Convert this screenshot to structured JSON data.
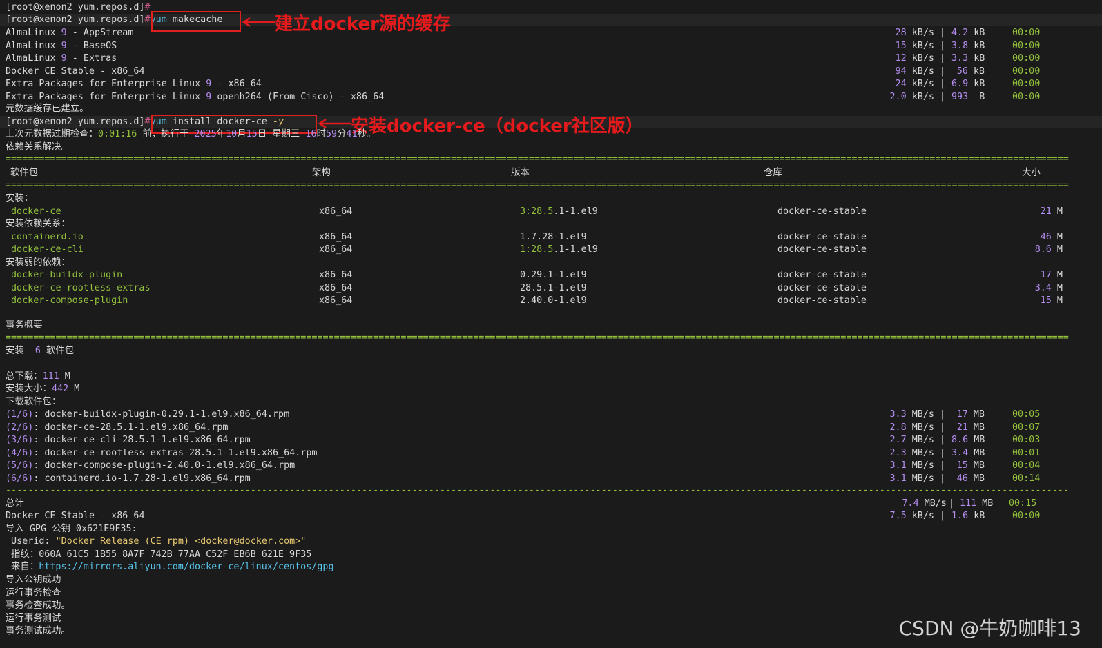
{
  "prompt": {
    "p1": "[root@xenon2 yum.repos.d]",
    "hash": "#",
    "cmd1": "yum makecache",
    "cmd2a": "yum install docker-ce ",
    "cmd2b": "-y"
  },
  "annotations": {
    "a1": "建立docker源的缓存",
    "a2": "安装docker-ce（docker社区版）"
  },
  "makecache": [
    {
      "name": "AlmaLinux ",
      "n": "9",
      "rest": " - AppStream",
      "speed": "28",
      "sunit": " kB/s",
      "size": "4.2",
      "zunit": " kB",
      "time": "00:00"
    },
    {
      "name": "AlmaLinux ",
      "n": "9",
      "rest": " - BaseOS",
      "speed": "15",
      "sunit": " kB/s",
      "size": "3.8",
      "zunit": " kB",
      "time": "00:00"
    },
    {
      "name": "AlmaLinux ",
      "n": "9",
      "rest": " - Extras",
      "speed": "12",
      "sunit": " kB/s",
      "size": "3.3",
      "zunit": " kB",
      "time": "00:00"
    },
    {
      "name": "Docker CE Stable - x86_64",
      "n": "",
      "rest": "",
      "speed": "94",
      "sunit": " kB/s",
      "size": "56",
      "zunit": " kB",
      "time": "00:00"
    },
    {
      "name": "Extra Packages for Enterprise Linux ",
      "n": "9",
      "rest": " - x86_64",
      "speed": "24",
      "sunit": " kB/s",
      "size": "6.9",
      "zunit": " kB",
      "time": "00:00"
    },
    {
      "name": "Extra Packages for Enterprise Linux ",
      "n": "9",
      "rest": " openh264 (From Cisco) - x86_64",
      "speed": "2.0",
      "sunit": " kB/s",
      "size": "993",
      "zunit": "  B",
      "time": "00:00"
    }
  ],
  "cache_done": "元数据缓存已建立。",
  "meta_check": {
    "pre": "上次元数据过期检查：",
    "elapsed": "0:01:16",
    "mid": " 前，执行于 ",
    "year": "2025",
    "y": "年",
    "month": "10",
    "m": "月",
    "day": "15",
    "d": "日 星期三 ",
    "hour": "16",
    "h": "时",
    "min": "59",
    "mi": "分",
    "sec": "41",
    "s": "秒。"
  },
  "deps_resolved": "依赖关系解决。",
  "eq_rule": "================================================================================================================================================================================================",
  "dash_rule": "----------------------------------------------------------------------------------------------------------------------------------------------------------------------------------------------------------------",
  "table_header": {
    "pkg": "软件包",
    "arch": "架构",
    "ver": "版本",
    "repo": "仓库",
    "size": "大小"
  },
  "sections": [
    {
      "title": "安装：",
      "rows": [
        {
          "pkg": "docker-ce",
          "arch": "x86_64",
          "ver_a": "3:28.5",
          "ver_b": ".1-1.el9",
          "verColor": true,
          "repo": "docker-ce-stable",
          "size": "21",
          "unit": " M"
        }
      ]
    },
    {
      "title": "安装依赖关系：",
      "rows": [
        {
          "pkg": "containerd.io",
          "arch": "x86_64",
          "ver_a": "",
          "ver_b": "1.7.28-1.el9",
          "verColor": false,
          "repo": "docker-ce-stable",
          "size": "46",
          "unit": " M"
        },
        {
          "pkg": "docker-ce-cli",
          "arch": "x86_64",
          "ver_a": "1:28.5",
          "ver_b": ".1-1.el9",
          "verColor": true,
          "repo": "docker-ce-stable",
          "size": "8.6",
          "unit": " M"
        }
      ]
    },
    {
      "title": "安装弱的依赖：",
      "rows": [
        {
          "pkg": "docker-buildx-plugin",
          "arch": "x86_64",
          "ver_a": "",
          "ver_b": "0.29.1-1.el9",
          "verColor": false,
          "repo": "docker-ce-stable",
          "size": "17",
          "unit": " M"
        },
        {
          "pkg": "docker-ce-rootless-extras",
          "arch": "x86_64",
          "ver_a": "",
          "ver_b": "28.5.1-1.el9",
          "verColor": false,
          "repo": "docker-ce-stable",
          "size": "3.4",
          "unit": " M"
        },
        {
          "pkg": "docker-compose-plugin",
          "arch": "x86_64",
          "ver_a": "",
          "ver_b": "2.40.0-1.el9",
          "verColor": false,
          "repo": "docker-ce-stable",
          "size": "15",
          "unit": " M"
        }
      ]
    }
  ],
  "summary": {
    "title": "事务概要",
    "install_pre": "安装  ",
    "install_n": "6",
    "install_post": " 软件包",
    "dl_pre": "总下载：",
    "dl_n": "111",
    "dl_post": " M",
    "inst_pre": "安装大小：",
    "inst_n": "442",
    "inst_post": " M",
    "dl_label": "下载软件包："
  },
  "downloads": [
    {
      "idx": "(1/6)",
      "file": ": docker-buildx-plugin-0.29.1-1.el9.x86_64.rpm",
      "speed": "3.3",
      "sunit": " MB/s",
      "size": "17",
      "zunit": " MB",
      "time": "00:05"
    },
    {
      "idx": "(2/6)",
      "file": ": docker-ce-28.5.1-1.el9.x86_64.rpm",
      "speed": "2.8",
      "sunit": " MB/s",
      "size": "21",
      "zunit": " MB",
      "time": "00:07"
    },
    {
      "idx": "(3/6)",
      "file": ": docker-ce-cli-28.5.1-1.el9.x86_64.rpm",
      "speed": "2.7",
      "sunit": " MB/s",
      "size": "8.6",
      "zunit": " MB",
      "time": "00:03"
    },
    {
      "idx": "(4/6)",
      "file": ": docker-ce-rootless-extras-28.5.1-1.el9.x86_64.rpm",
      "speed": "2.3",
      "sunit": " MB/s",
      "size": "3.4",
      "zunit": " MB",
      "time": "00:01"
    },
    {
      "idx": "(5/6)",
      "file": ": docker-compose-plugin-2.40.0-1.el9.x86_64.rpm",
      "speed": "3.1",
      "sunit": " MB/s",
      "size": "15",
      "zunit": " MB",
      "time": "00:04"
    },
    {
      "idx": "(6/6)",
      "file": ": containerd.io-1.7.28-1.el9.x86_64.rpm",
      "speed": "3.1",
      "sunit": " MB/s",
      "size": "46",
      "zunit": " MB",
      "time": "00:14"
    }
  ],
  "total": {
    "label": "总计",
    "speed": "7.4",
    "sunit": " MB/s",
    "size": "111",
    "zunit": " MB",
    "time": "00:15"
  },
  "docker_stable": {
    "label": "Docker CE Stable ",
    "dash": "-",
    "rest": " x86_64",
    "speed": "7.5",
    "sunit": " kB/s",
    "size": "1.6",
    "zunit": " kB",
    "time": "00:00"
  },
  "gpg": {
    "import": "导入 GPG 公钥 0x621E9F35:",
    "userid_label": " Userid: ",
    "userid": "\"Docker Release (CE rpm) <docker@docker.com>\"",
    "fp_label": " 指纹：",
    "fp": "060A 61C5 1B55 8A7F 742B 77AA C52F EB6B 621E 9F35",
    "from_label": " 来自：",
    "from": "https://mirrors.aliyun.com/docker-ce/linux/centos/gpg"
  },
  "tail": [
    "导入公钥成功",
    "运行事务检查",
    "事务检查成功。",
    "运行事务测试",
    "事务测试成功。"
  ],
  "watermark": "CSDN @牛奶咖啡13",
  "colors": {
    "accent_red": "#e41a1c",
    "number_purple": "#b48ef0",
    "package_green": "#93c13c",
    "prompt_cyan": "#55c2e8"
  }
}
